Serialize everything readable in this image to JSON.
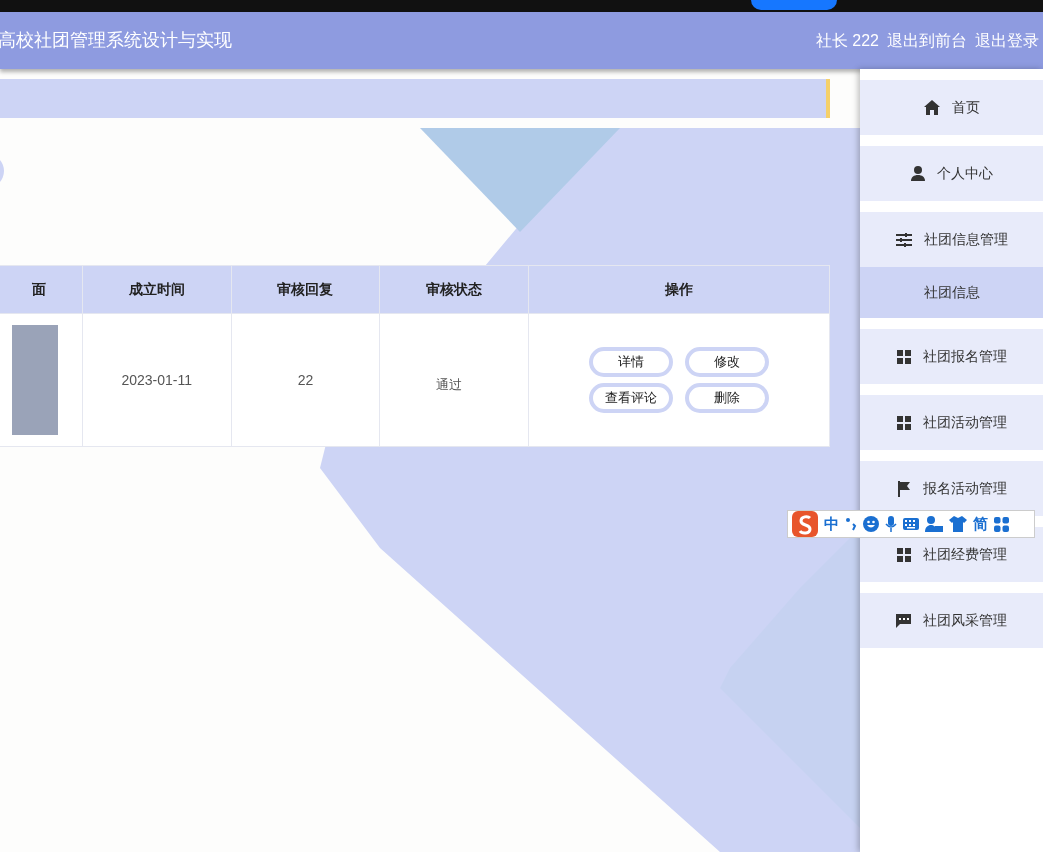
{
  "header": {
    "title": "高校社团管理系统设计与实现",
    "user": "社长 222",
    "links": [
      "退出到前台",
      "退出登录"
    ]
  },
  "sidebar": {
    "items": [
      {
        "label": "首页"
      },
      {
        "label": "个人中心"
      },
      {
        "label": "社团信息管理",
        "children": [
          {
            "label": "社团信息"
          }
        ]
      },
      {
        "label": "社团报名管理"
      },
      {
        "label": "社团活动管理"
      },
      {
        "label": "报名活动管理"
      },
      {
        "label": "社团经费管理"
      },
      {
        "label": "社团风采管理"
      }
    ]
  },
  "table": {
    "columns": [
      "面",
      "成立时间",
      "审核回复",
      "审核状态",
      "操作"
    ],
    "rows": [
      {
        "cells": [
          "",
          "2023-01-11",
          "22",
          "通过"
        ],
        "actions": [
          "详情",
          "修改",
          "查看评论",
          "删除"
        ]
      }
    ]
  },
  "ime_toolbar": {
    "texts": [
      "中",
      "简"
    ]
  }
}
